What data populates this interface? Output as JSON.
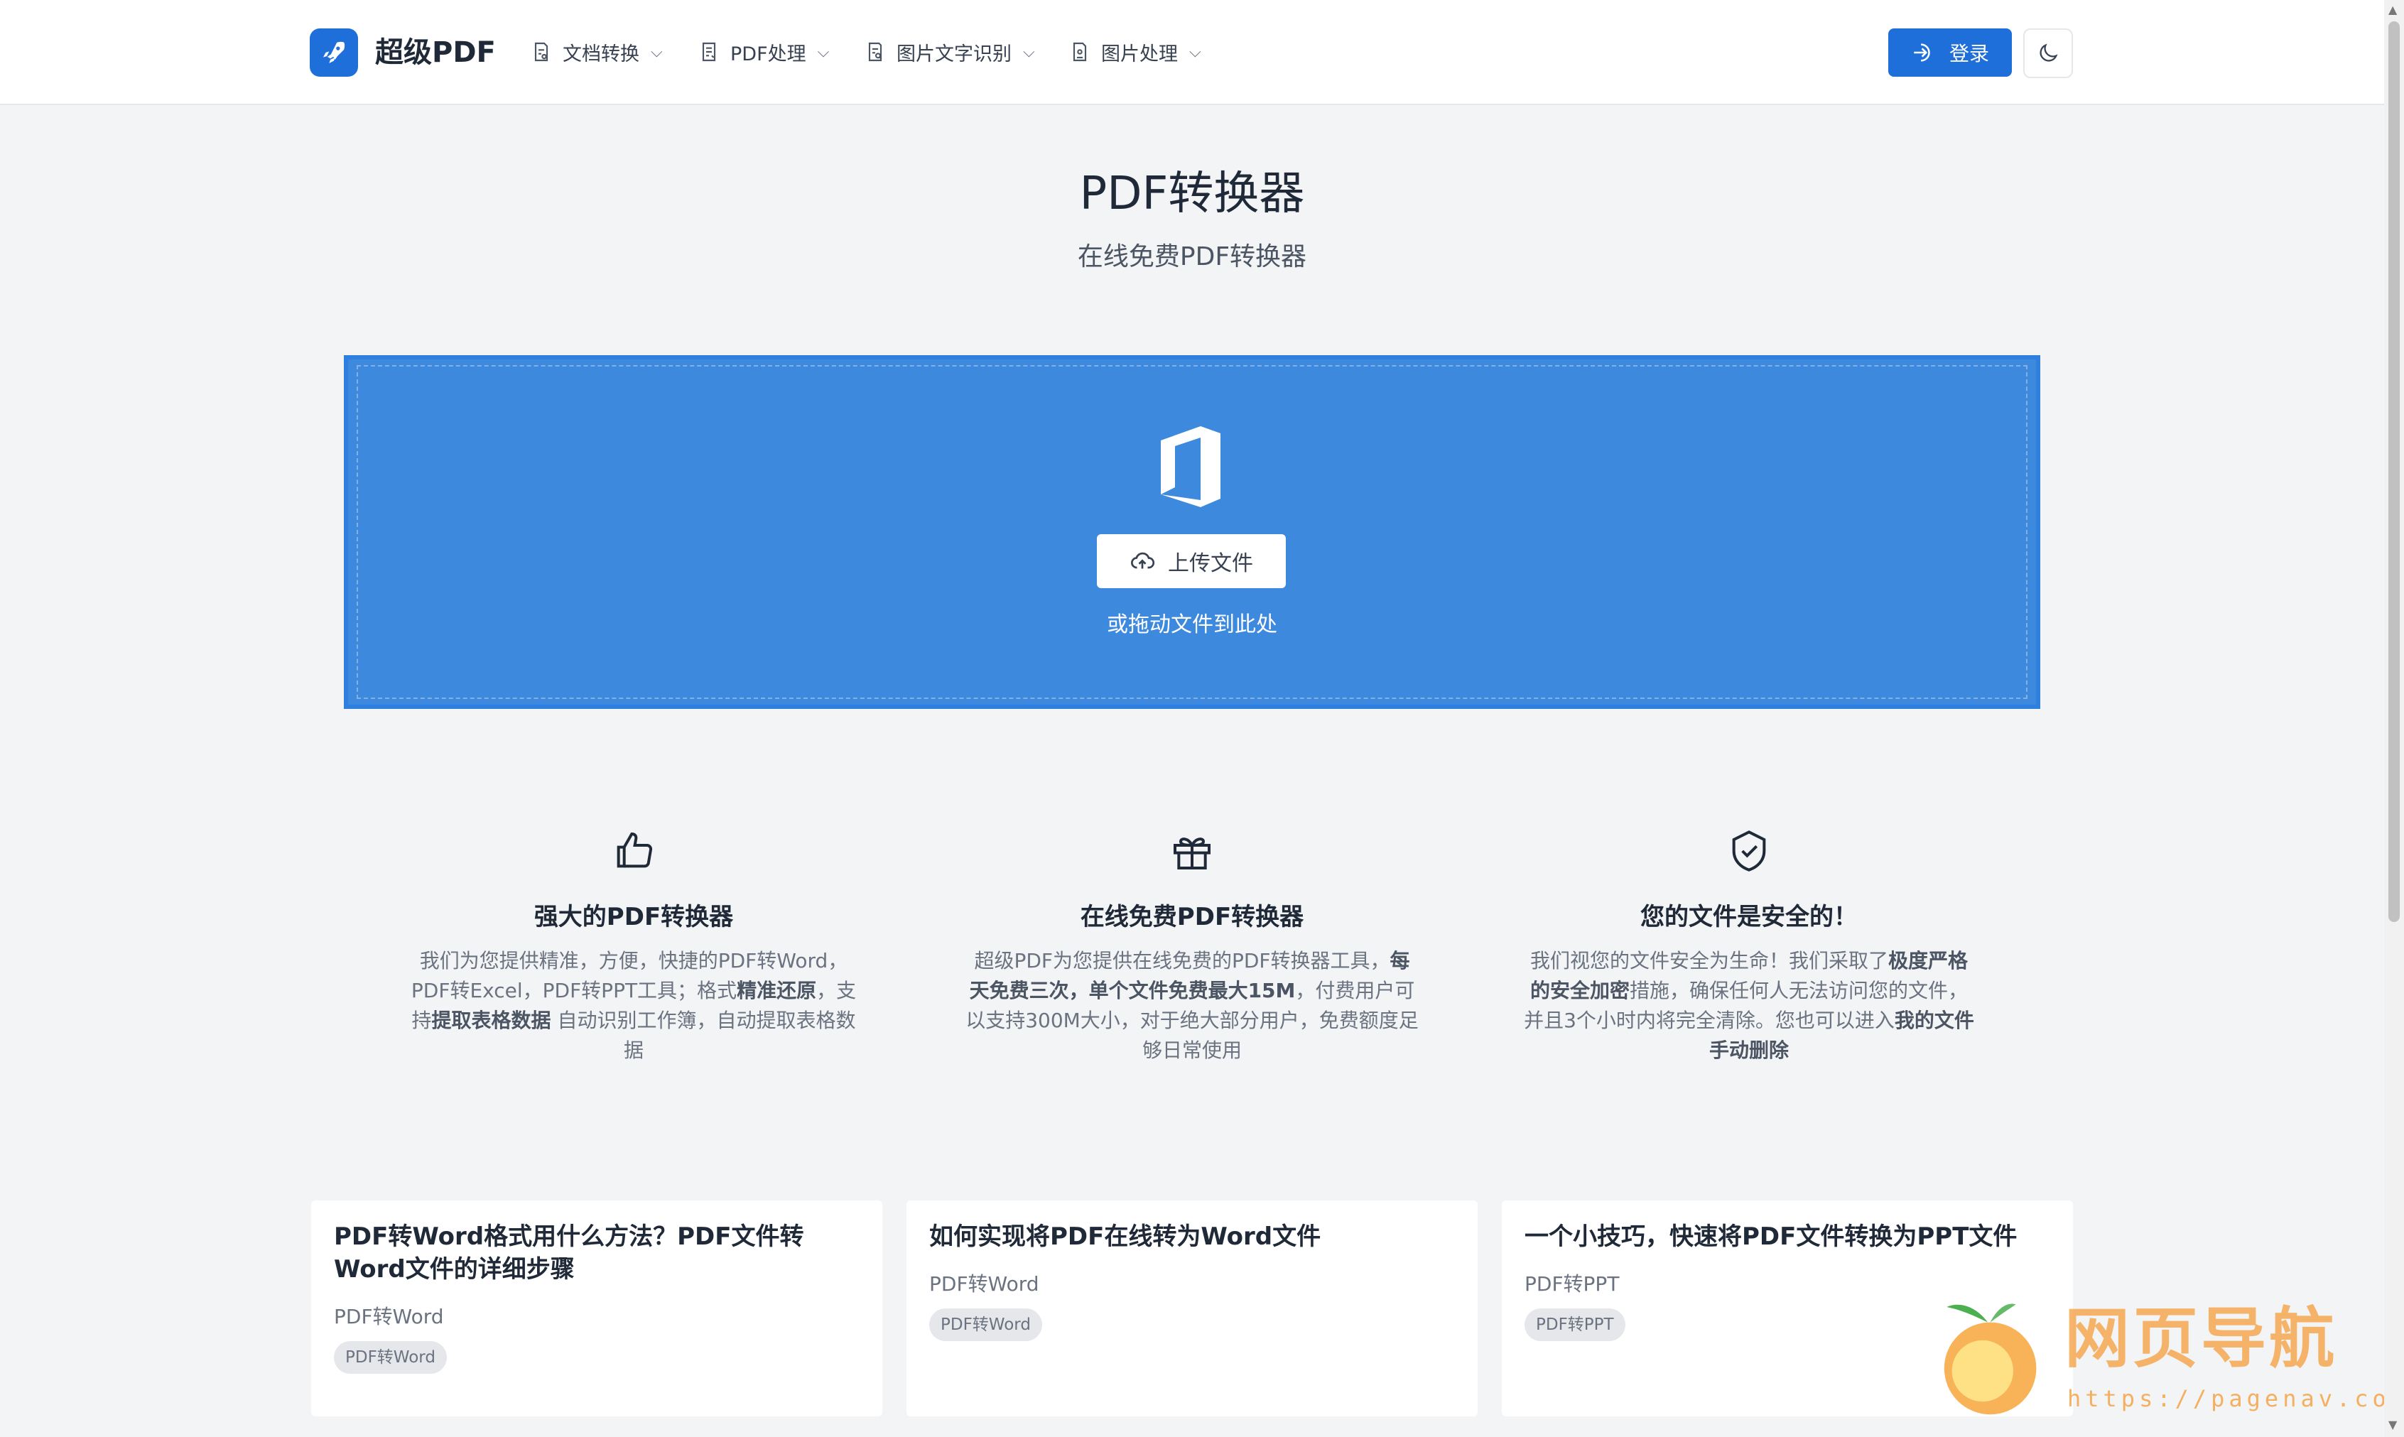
{
  "brand": {
    "name": "超级PDF",
    "accent": "#1e6fd9"
  },
  "nav": {
    "items": [
      {
        "label": "文档转换",
        "icon": "doc-convert-icon"
      },
      {
        "label": "PDF处理",
        "icon": "pdf-process-icon"
      },
      {
        "label": "图片文字识别",
        "icon": "ocr-icon"
      },
      {
        "label": "图片处理",
        "icon": "image-process-icon"
      }
    ],
    "login_label": "登录",
    "theme_icon": "moon-icon"
  },
  "hero": {
    "title": "PDF转换器",
    "subtitle": "在线免费PDF转换器"
  },
  "upload": {
    "button_label": "上传文件",
    "drag_hint": "或拖动文件到此处",
    "zone_color": "#3c89dd"
  },
  "features": [
    {
      "icon": "thumbs-up-icon",
      "title": "强大的PDF转换器",
      "desc_parts": [
        "我们为您提供精准，方便，快捷的PDF转Word，PDF转Excel，PDF转PPT工具；格式",
        "精准还原",
        "，支持",
        "提取表格数据",
        "自动识别工作簿，自动提取表格数据"
      ]
    },
    {
      "icon": "gift-icon",
      "title": "在线免费PDF转换器",
      "desc_parts": [
        "超级PDF为您提供在线免费的PDF转换器工具，",
        "每天免费三次，单个文件免费最大15M",
        "，付费用户可以支持300M大小，对于绝大部分用户，免费额度足够日常使用"
      ]
    },
    {
      "icon": "shield-check-icon",
      "title": "您的文件是安全的！",
      "desc_parts": [
        "我们视您的文件安全为生命！我们采取了",
        "极度严格的安全加密",
        "措施，确保任何人无法访问您的文件，并且3个小时内将完全清除。您也可以进入",
        "我的文件手动删除"
      ]
    }
  ],
  "articles": [
    {
      "title": "PDF转Word格式用什么方法？PDF文件转Word文件的详细步骤",
      "category": "PDF转Word",
      "tag": "PDF转Word"
    },
    {
      "title": "如何实现将PDF在线转为Word文件",
      "category": "PDF转Word",
      "tag": "PDF转Word"
    },
    {
      "title": "一个小技巧，快速将PDF文件转换为PPT文件",
      "category": "PDF转PPT",
      "tag": "PDF转PPT"
    }
  ],
  "watermark": {
    "text": "网页导航",
    "url": "https://pagenav.com"
  }
}
